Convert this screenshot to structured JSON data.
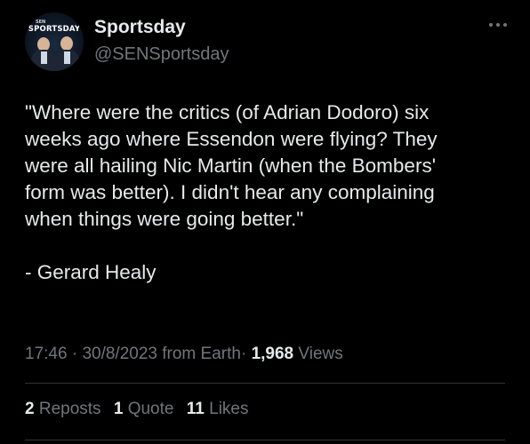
{
  "author": {
    "display_name": "Sportsday",
    "handle": "@SENSportsday",
    "avatar_label": "SPORTSDAY",
    "avatar_small_label": "SEN"
  },
  "tweet": {
    "quote_text": "\"Where were the critics (of Adrian Dodoro) six\nweeks ago where Essendon were flying? They\nwere all hailing Nic Martin (when the Bombers'\nform was better). I didn't hear any complaining\nwhen things were going better.\"",
    "attribution": "- Gerard Healy"
  },
  "meta": {
    "time": "17:46",
    "date": "30/8/2023",
    "source": "from Earth",
    "separator": "·",
    "views_count": "1,968",
    "views_label": "Views"
  },
  "stats": {
    "reposts_count": "2",
    "reposts_label": "Reposts",
    "quotes_count": "1",
    "quotes_label": "Quote",
    "likes_count": "11",
    "likes_label": "Likes"
  },
  "colors": {
    "background": "#000000",
    "primary_text": "#e7e9ea",
    "secondary_text": "#71767b",
    "divider": "#2f3336"
  }
}
